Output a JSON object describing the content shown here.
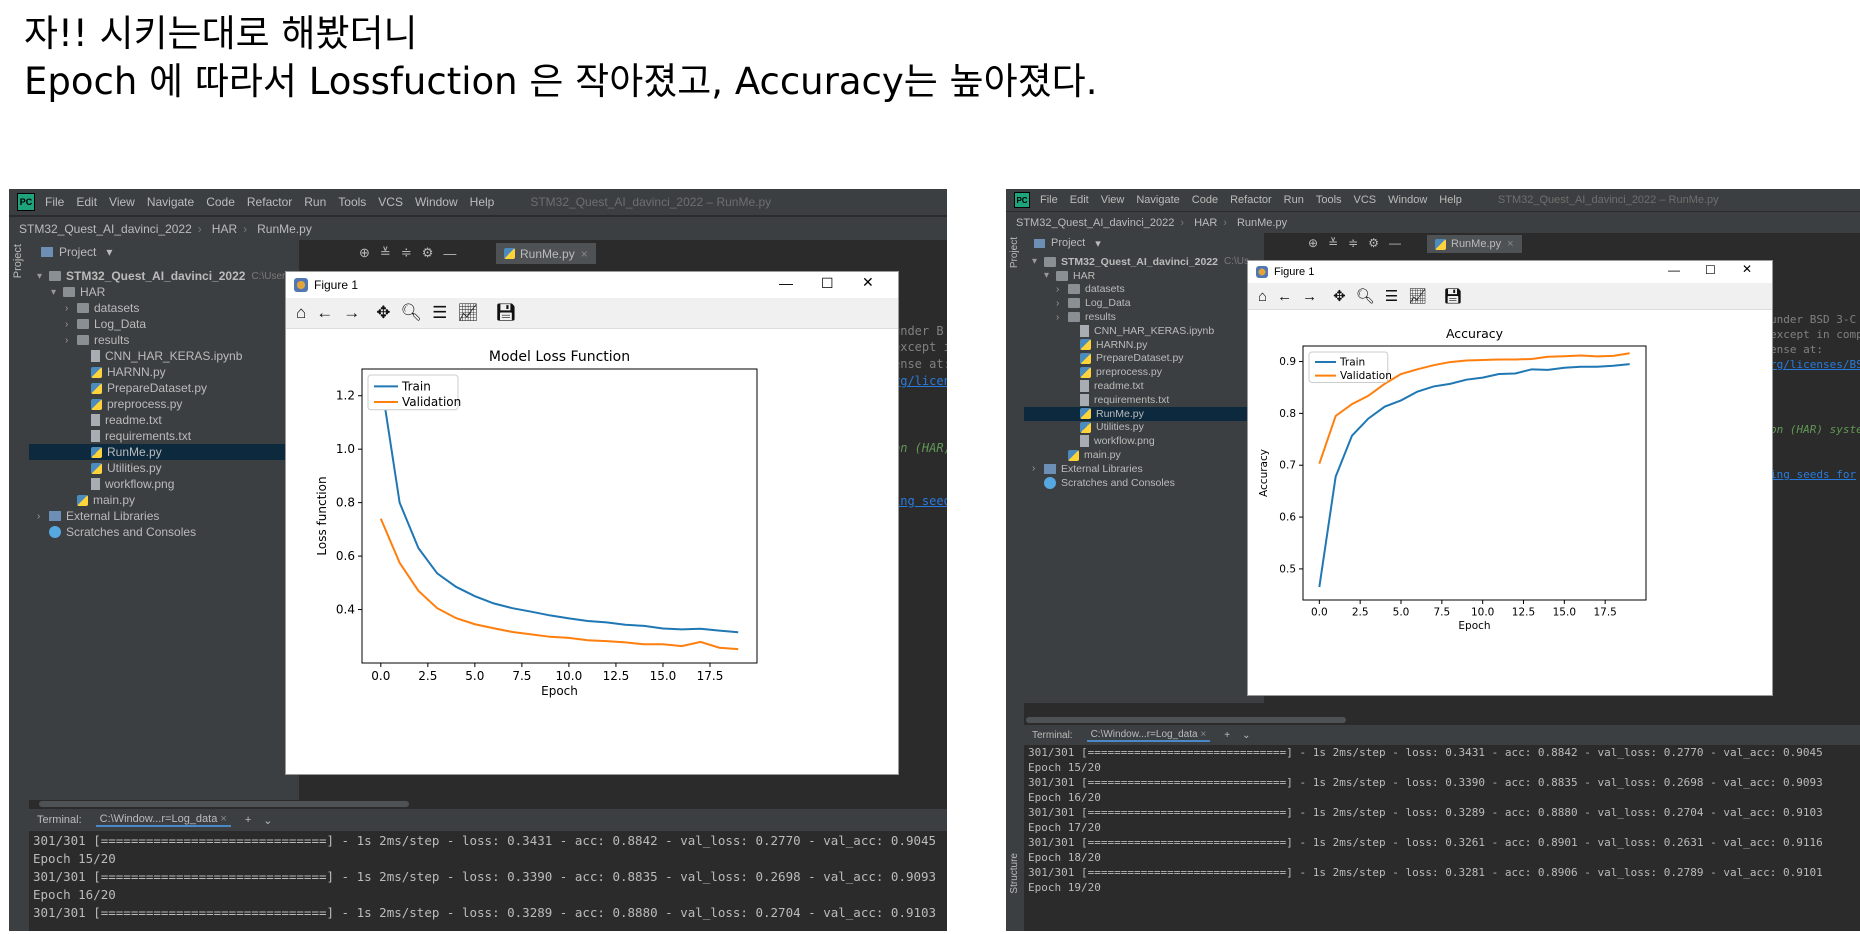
{
  "caption": {
    "line1": "자!! 시키는대로 해봤더니",
    "line2": "Epoch 에 따라서 Lossfuction 은 작아졌고, Accuracy는 높아졌다."
  },
  "ide": {
    "logo": "PC",
    "menu": [
      "File",
      "Edit",
      "View",
      "Navigate",
      "Code",
      "Refactor",
      "Run",
      "Tools",
      "VCS",
      "Window",
      "Help"
    ],
    "window_title": "STM32_Quest_AI_davinci_2022 – RunMe.py",
    "breadcrumb": [
      "STM32_Quest_AI_davinci_2022",
      "HAR",
      "RunMe.py"
    ],
    "sidebar_project_label": "Project",
    "sidebar_structure_label": "Structure",
    "project_header": "Project",
    "editor_tab": "RunMe.py",
    "tree": [
      {
        "label": "STM32_Quest_AI_davinci_2022",
        "type": "folder",
        "level": 0,
        "arrow": "▾",
        "bold": true
      },
      {
        "label": "HAR",
        "type": "folder",
        "level": 1,
        "arrow": "▾"
      },
      {
        "label": "datasets",
        "type": "folder",
        "level": 2,
        "arrow": "›"
      },
      {
        "label": "Log_Data",
        "type": "folder",
        "level": 2,
        "arrow": "›"
      },
      {
        "label": "results",
        "type": "folder",
        "level": 2,
        "arrow": "›"
      },
      {
        "label": "CNN_HAR_KERAS.ipynb",
        "type": "file",
        "level": 3
      },
      {
        "label": "HARNN.py",
        "type": "py",
        "level": 3
      },
      {
        "label": "PrepareDataset.py",
        "type": "py",
        "level": 3
      },
      {
        "label": "preprocess.py",
        "type": "py",
        "level": 3
      },
      {
        "label": "readme.txt",
        "type": "file",
        "level": 3
      },
      {
        "label": "requirements.txt",
        "type": "file",
        "level": 3
      },
      {
        "label": "RunMe.py",
        "type": "py",
        "level": 3,
        "selected": true
      },
      {
        "label": "Utilities.py",
        "type": "py",
        "level": 3
      },
      {
        "label": "workflow.png",
        "type": "file",
        "level": 3
      },
      {
        "label": "main.py",
        "type": "py",
        "level": 2
      },
      {
        "label": "External Libraries",
        "type": "lib",
        "level": 0,
        "arrow": "›"
      },
      {
        "label": "Scratches and Consoles",
        "type": "scratch",
        "level": 0
      }
    ],
    "path_left": "C:\\Users",
    "path_right": "C:\\Us",
    "editor_left": [
      {
        "text": "under B",
        "cls": ""
      },
      {
        "text": "except i",
        "cls": ""
      },
      {
        "text": "ense at:",
        "cls": ""
      },
      {
        "text": "rg/licen",
        "cls": "link"
      },
      {
        "text": "on (HAR)",
        "cls": "green"
      },
      {
        "text": "ing seed",
        "cls": "link"
      }
    ],
    "editor_right": [
      {
        "text": "under BSD 3-C",
        "cls": ""
      },
      {
        "text": "except in comp",
        "cls": ""
      },
      {
        "text": "ense at:",
        "cls": ""
      },
      {
        "text": "rg/licenses/BS",
        "cls": "link"
      },
      {
        "text": "on (HAR) syste",
        "cls": "green"
      },
      {
        "text": "ing seeds for",
        "cls": "link"
      }
    ],
    "terminal": {
      "label": "Terminal:",
      "tab": "C:\\Window...r=Log_data",
      "lines_left": [
        "301/301 [==============================] - 1s 2ms/step - loss: 0.3431 - acc: 0.8842 - val_loss: 0.2770 - val_acc: 0.9045",
        "Epoch 15/20",
        "301/301 [==============================] - 1s 2ms/step - loss: 0.3390 - acc: 0.8835 - val_loss: 0.2698 - val_acc: 0.9093",
        "Epoch 16/20",
        "301/301 [==============================] - 1s 2ms/step - loss: 0.3289 - acc: 0.8880 - val_loss: 0.2704 - val_acc: 0.9103"
      ],
      "lines_right": [
        "301/301 [==============================] - 1s 2ms/step - loss: 0.3431 - acc: 0.8842 - val_loss: 0.2770 - val_acc: 0.9045",
        "Epoch 15/20",
        "301/301 [==============================] - 1s 2ms/step - loss: 0.3390 - acc: 0.8835 - val_loss: 0.2698 - val_acc: 0.9093",
        "Epoch 16/20",
        "301/301 [==============================] - 1s 2ms/step - loss: 0.3289 - acc: 0.8880 - val_loss: 0.2704 - val_acc: 0.9103",
        "Epoch 17/20",
        "301/301 [==============================] - 1s 2ms/step - loss: 0.3261 - acc: 0.8901 - val_loss: 0.2631 - val_acc: 0.9116",
        "Epoch 18/20",
        "301/301 [==============================] - 1s 2ms/step - loss: 0.3281 - acc: 0.8906 - val_loss: 0.2789 - val_acc: 0.9101",
        "Epoch 19/20"
      ]
    }
  },
  "figure": {
    "window_title": "Figure 1",
    "toolbar_icons": [
      "home-icon",
      "back-icon",
      "forward-icon",
      "pan-icon",
      "zoom-icon",
      "configure-icon",
      "edit-axis-icon",
      "save-icon"
    ]
  },
  "colors": {
    "train": "#1f77b4",
    "validation": "#ff7f0e",
    "ide_bg": "#2b2b2b",
    "ide_panel": "#3c3f41",
    "selection": "#0d293e"
  },
  "chart_data": [
    {
      "type": "line",
      "title": "Model Loss Function",
      "xlabel": "Epoch",
      "ylabel": "Loss function",
      "x": [
        0,
        1,
        2,
        3,
        4,
        5,
        6,
        7,
        8,
        9,
        10,
        11,
        12,
        13,
        14,
        15,
        16,
        17,
        18,
        19
      ],
      "series": [
        {
          "name": "Train",
          "color": "#1f77b4",
          "values": [
            1.26,
            0.8,
            0.63,
            0.535,
            0.485,
            0.45,
            0.423,
            0.405,
            0.392,
            0.378,
            0.367,
            0.357,
            0.352,
            0.343,
            0.339,
            0.329,
            0.326,
            0.328,
            0.321,
            0.315
          ]
        },
        {
          "name": "Validation",
          "color": "#ff7f0e",
          "values": [
            0.74,
            0.575,
            0.47,
            0.405,
            0.368,
            0.345,
            0.33,
            0.316,
            0.307,
            0.298,
            0.294,
            0.285,
            0.282,
            0.277,
            0.27,
            0.27,
            0.263,
            0.279,
            0.257,
            0.252
          ]
        }
      ],
      "xlim": [
        -1,
        20
      ],
      "ylim": [
        0.2,
        1.3
      ],
      "xticks": [
        0.0,
        2.5,
        5.0,
        7.5,
        10.0,
        12.5,
        15.0,
        17.5
      ],
      "xtick_labels": [
        "0.0",
        "2.5",
        "5.0",
        "7.5",
        "10.0",
        "12.5",
        "15.0",
        "17.5"
      ],
      "yticks": [
        0.4,
        0.6,
        0.8,
        1.0,
        1.2
      ],
      "ytick_labels": [
        "0.4",
        "0.6",
        "0.8",
        "1.0",
        "1.2"
      ],
      "legend": "top-left",
      "grid": false
    },
    {
      "type": "line",
      "title": "Accuracy",
      "xlabel": "Epoch",
      "ylabel": "Accuracy",
      "x": [
        0,
        1,
        2,
        3,
        4,
        5,
        6,
        7,
        8,
        9,
        10,
        11,
        12,
        13,
        14,
        15,
        16,
        17,
        18,
        19
      ],
      "series": [
        {
          "name": "Train",
          "color": "#1f77b4",
          "values": [
            0.465,
            0.678,
            0.757,
            0.79,
            0.813,
            0.825,
            0.842,
            0.852,
            0.857,
            0.865,
            0.869,
            0.876,
            0.877,
            0.885,
            0.884,
            0.888,
            0.89,
            0.89,
            0.892,
            0.895
          ]
        },
        {
          "name": "Validation",
          "color": "#ff7f0e",
          "values": [
            0.703,
            0.795,
            0.818,
            0.834,
            0.857,
            0.876,
            0.885,
            0.893,
            0.899,
            0.902,
            0.903,
            0.904,
            0.904,
            0.905,
            0.9093,
            0.9103,
            0.9116,
            0.9101,
            0.911,
            0.916
          ]
        }
      ],
      "xlim": [
        -1,
        20
      ],
      "ylim": [
        0.44,
        0.93
      ],
      "xticks": [
        0.0,
        2.5,
        5.0,
        7.5,
        10.0,
        12.5,
        15.0,
        17.5
      ],
      "xtick_labels": [
        "0.0",
        "2.5",
        "5.0",
        "7.5",
        "10.0",
        "12.5",
        "15.0",
        "17.5"
      ],
      "yticks": [
        0.5,
        0.6,
        0.7,
        0.8,
        0.9
      ],
      "ytick_labels": [
        "0.5",
        "0.6",
        "0.7",
        "0.8",
        "0.9"
      ],
      "legend": "top-left",
      "grid": false
    }
  ]
}
